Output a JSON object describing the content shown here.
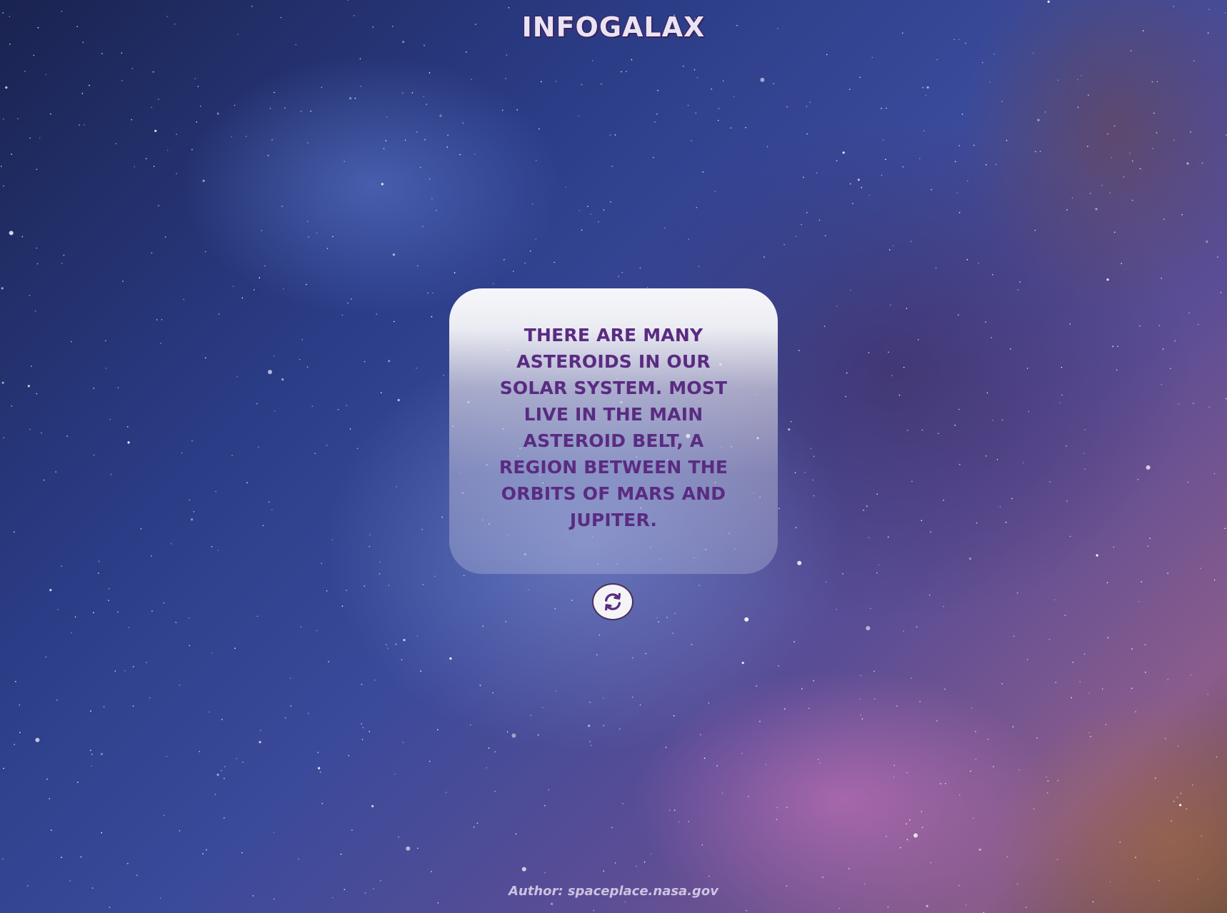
{
  "app": {
    "title": "INFOGALAX"
  },
  "fact_card": {
    "text": "There are many asteroids in our solar system. Most live in the main asteroid belt, a region between the orbits of Mars and Jupiter."
  },
  "refresh_button": {
    "icon": "refresh-icon"
  },
  "footer": {
    "author": "Author: spaceplace.nasa.gov"
  },
  "colors": {
    "text_purple": "#5a2b82",
    "title_outline": "#3d2160",
    "card_top": "#f8f8fa"
  }
}
